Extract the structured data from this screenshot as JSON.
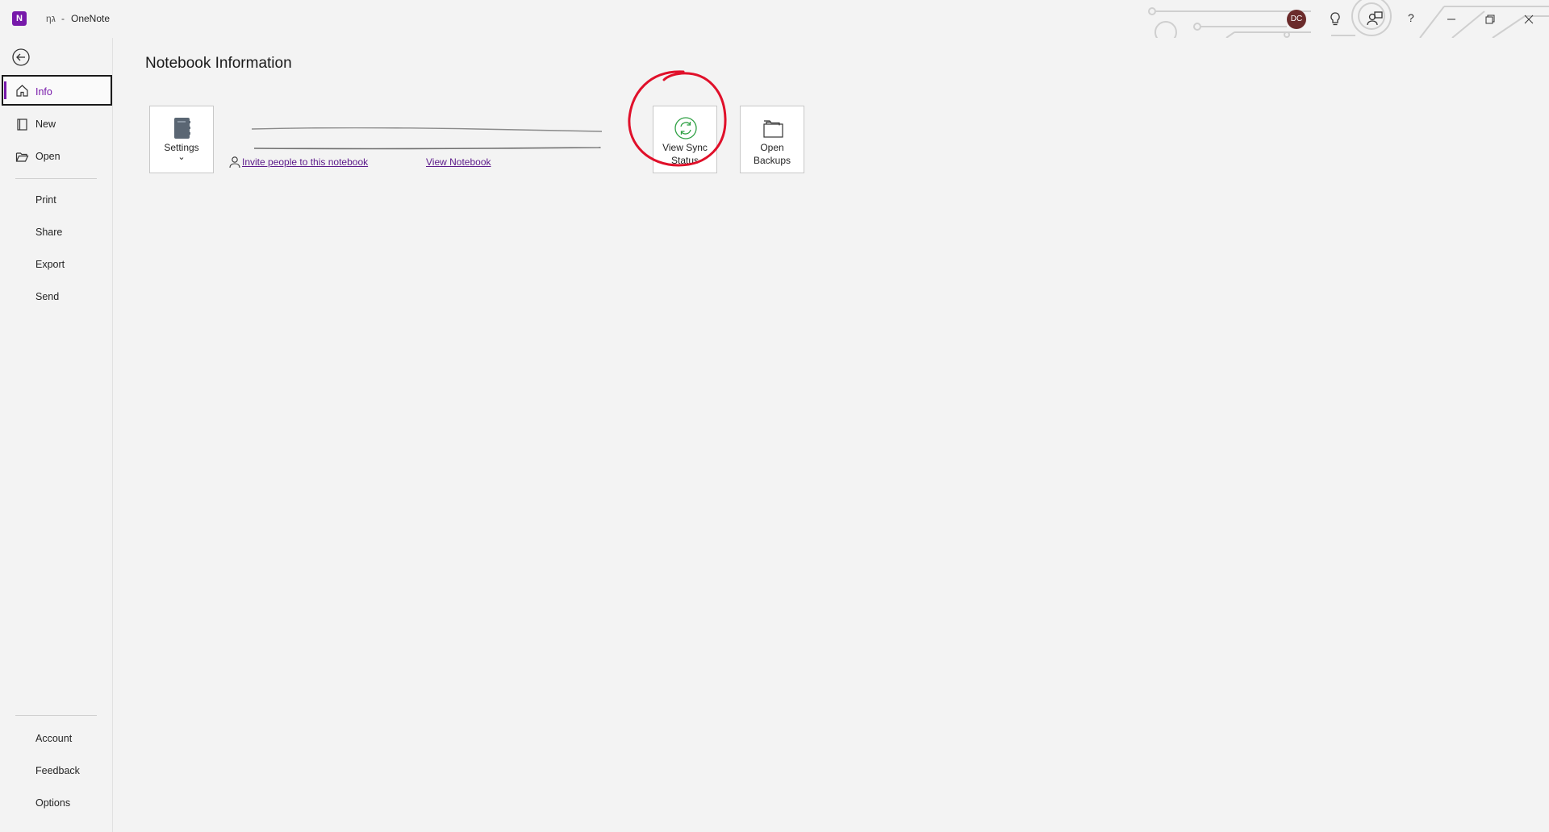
{
  "titlebar": {
    "logo_letter": "N",
    "doc_name": "ηג",
    "separator": "-",
    "app_title": "OneNote",
    "avatar_initials": "DC",
    "help_label": "?"
  },
  "nav": {
    "items": [
      {
        "label": "Info",
        "icon": "home-icon"
      },
      {
        "label": "New",
        "icon": "new-notebook-icon"
      },
      {
        "label": "Open",
        "icon": "folder-open-icon"
      },
      {
        "label": "Print"
      },
      {
        "label": "Share"
      },
      {
        "label": "Export"
      },
      {
        "label": "Send"
      },
      {
        "label": "Account"
      },
      {
        "label": "Feedback"
      },
      {
        "label": "Options"
      }
    ]
  },
  "main": {
    "title": "Notebook Information",
    "settings_tile": {
      "label": "Settings",
      "chevron": "⌄"
    },
    "invite_link": "Invite people to this notebook",
    "view_notebook_link": "View Notebook",
    "sync_tile": {
      "line1": "View Sync",
      "line2": "Status"
    },
    "backups_tile": {
      "line1": "Open",
      "line2": "Backups"
    }
  },
  "colors": {
    "accent": "#7719aa",
    "annotation": "#e0102a",
    "sync_green": "#2ea043"
  }
}
